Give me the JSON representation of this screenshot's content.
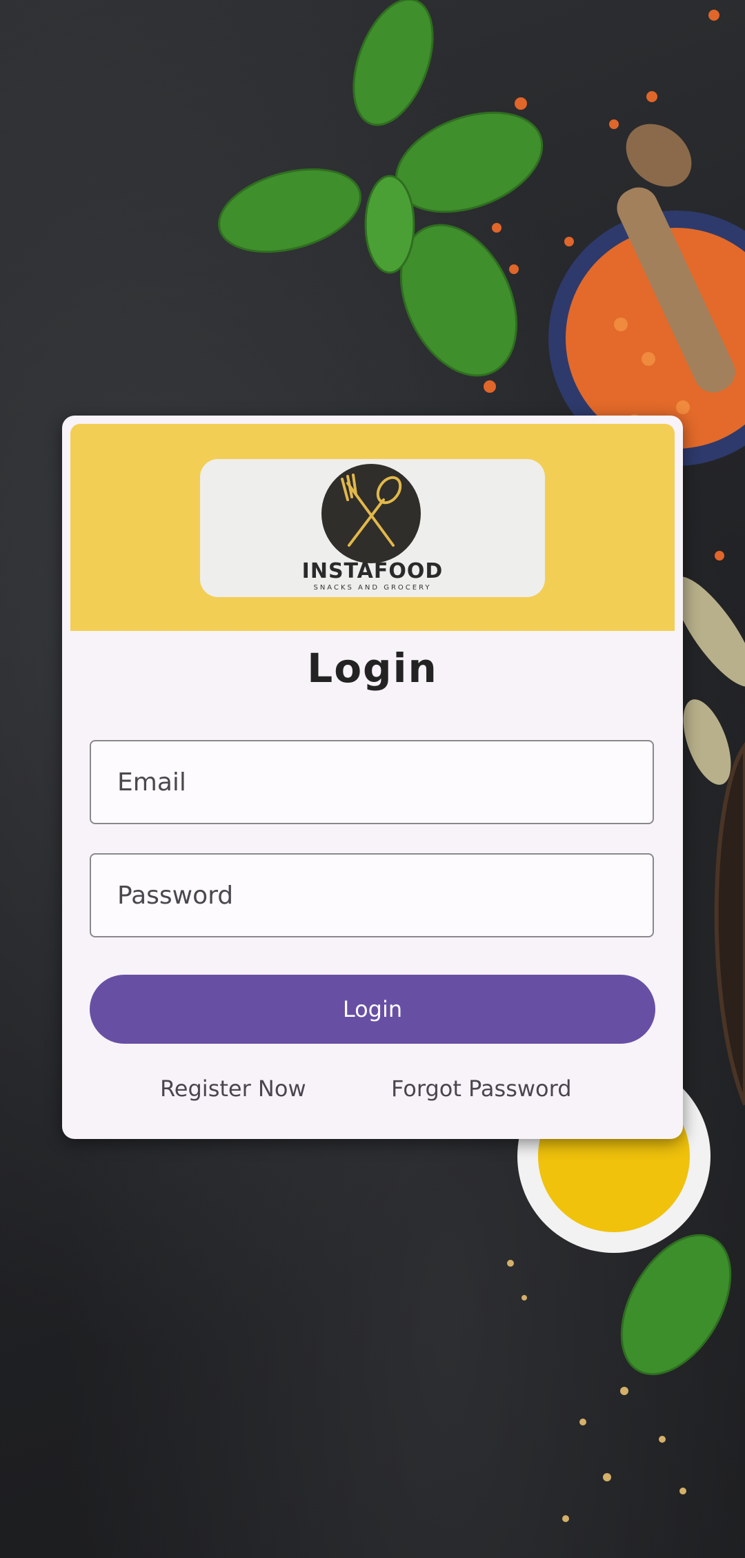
{
  "brand": {
    "name": "INSTAFOOD",
    "tagline": "SNACKS AND GROCERY"
  },
  "login": {
    "title": "Login",
    "email_placeholder": "Email",
    "password_placeholder": "Password",
    "submit_label": "Login",
    "register_link": "Register Now",
    "forgot_link": "Forgot Password"
  },
  "colors": {
    "header": "#f3ce55",
    "primary": "#6750a4",
    "card": "#f7f3f8",
    "background": "#202124"
  },
  "icons": {
    "logo": "fork-spoon-icon"
  }
}
